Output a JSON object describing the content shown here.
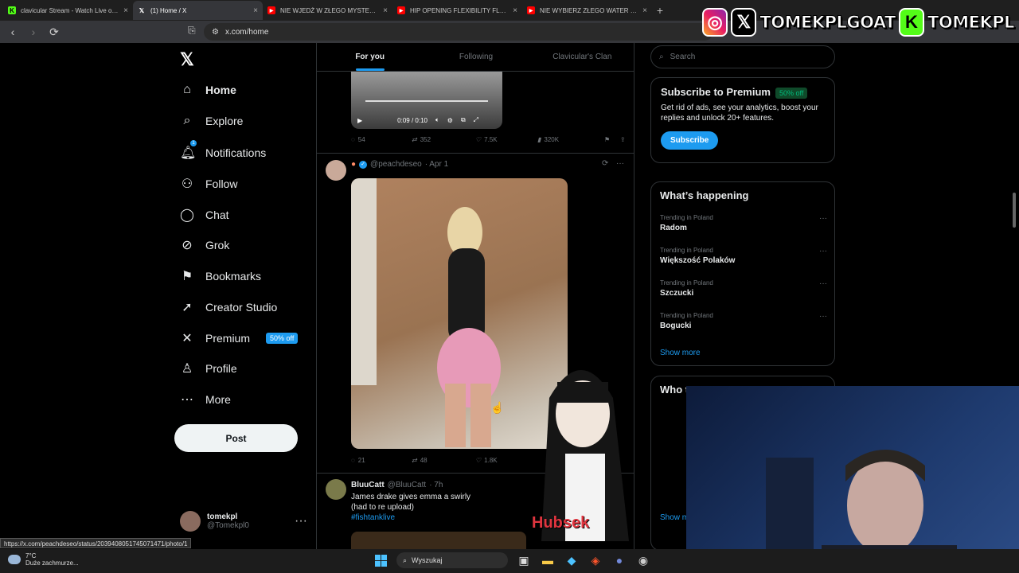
{
  "browser": {
    "tabs": [
      {
        "title": "clavicular Stream - Watch Live on Ki...",
        "fav": "K",
        "fav_color": "#53fc18",
        "active": false
      },
      {
        "title": "(1) Home / X",
        "fav": "X",
        "fav_color": "#000000",
        "active": true
      },
      {
        "title": "NIE WJEDŹ W ZŁEGO MYSTERY BOX...",
        "fav": "▶",
        "fav_color": "#ff0000",
        "active": false
      },
      {
        "title": "HIP OPENING FLEXIBILITY FLOW Dre...",
        "fav": "▶",
        "fav_color": "#ff0000",
        "active": false
      },
      {
        "title": "NIE WYBIERZ ZŁEGO WATER SLIDE'A...",
        "fav": "▶",
        "fav_color": "#ff0000",
        "active": false
      }
    ],
    "url": "x.com/home",
    "status_url": "https://x.com/peachdeseo/status/2039408051745071471/photo/1"
  },
  "banner": {
    "handle_x": "TOMEKPLGOAT",
    "handle_kick": "TOMEKPL"
  },
  "sidebar": {
    "items": [
      {
        "label": "Home",
        "icon": "home-icon"
      },
      {
        "label": "Explore",
        "icon": "search-icon"
      },
      {
        "label": "Notifications",
        "icon": "bell-icon"
      },
      {
        "label": "Follow",
        "icon": "add-person-icon"
      },
      {
        "label": "Chat",
        "icon": "chat-icon"
      },
      {
        "label": "Grok",
        "icon": "grok-icon"
      },
      {
        "label": "Bookmarks",
        "icon": "bookmark-icon"
      },
      {
        "label": "Creator Studio",
        "icon": "rocket-icon"
      },
      {
        "label": "Premium",
        "icon": "x-icon"
      },
      {
        "label": "Profile",
        "icon": "person-icon"
      },
      {
        "label": "More",
        "icon": "more-icon"
      }
    ],
    "notification_count": "1",
    "premium_badge": "50% off",
    "post_label": "Post",
    "account": {
      "name": "tomekpl",
      "handle": "@Tomekpl0"
    }
  },
  "feed": {
    "tabs": [
      "For you",
      "Following",
      "Clavicular's Clan"
    ],
    "video": {
      "time": "0:09 / 0:10"
    },
    "post1_actions": {
      "replies": "54",
      "reposts": "352",
      "likes": "7.5K",
      "views": "320K"
    },
    "post2": {
      "handle": "@peachdeseo",
      "date": "· Apr 1"
    },
    "post2_actions": {
      "replies": "21",
      "reposts": "48",
      "likes": "1.8K"
    },
    "post3": {
      "name": "BluuCatt",
      "handle": "@BluuCatt",
      "date": "· 7h",
      "text_line1": "James drake gives emma a swirly",
      "text_line2": "(had to re upload)",
      "hashtag": "#fishtanklive"
    }
  },
  "right": {
    "search_placeholder": "Search",
    "premium": {
      "title": "Subscribe to Premium",
      "badge": "50% off",
      "text": "Get rid of ads, see your analytics, boost your replies and unlock 20+ features.",
      "button": "Subscribe"
    },
    "happening": {
      "title": "What’s happening",
      "trends": [
        {
          "context": "Trending in Poland",
          "name": "Radom"
        },
        {
          "context": "Trending in Poland",
          "name": "Większość Polaków"
        },
        {
          "context": "Trending in Poland",
          "name": "Szczucki"
        },
        {
          "context": "Trending in Poland",
          "name": "Bogucki"
        }
      ],
      "show_more": "Show more"
    },
    "who_to_follow": {
      "title": "Who t",
      "show_more": "Show m"
    }
  },
  "overlay": {
    "hubsek": "Hubsek"
  },
  "taskbar": {
    "temp": "7°C",
    "weather": "Duże zachmurze...",
    "search": "Wyszukaj"
  }
}
